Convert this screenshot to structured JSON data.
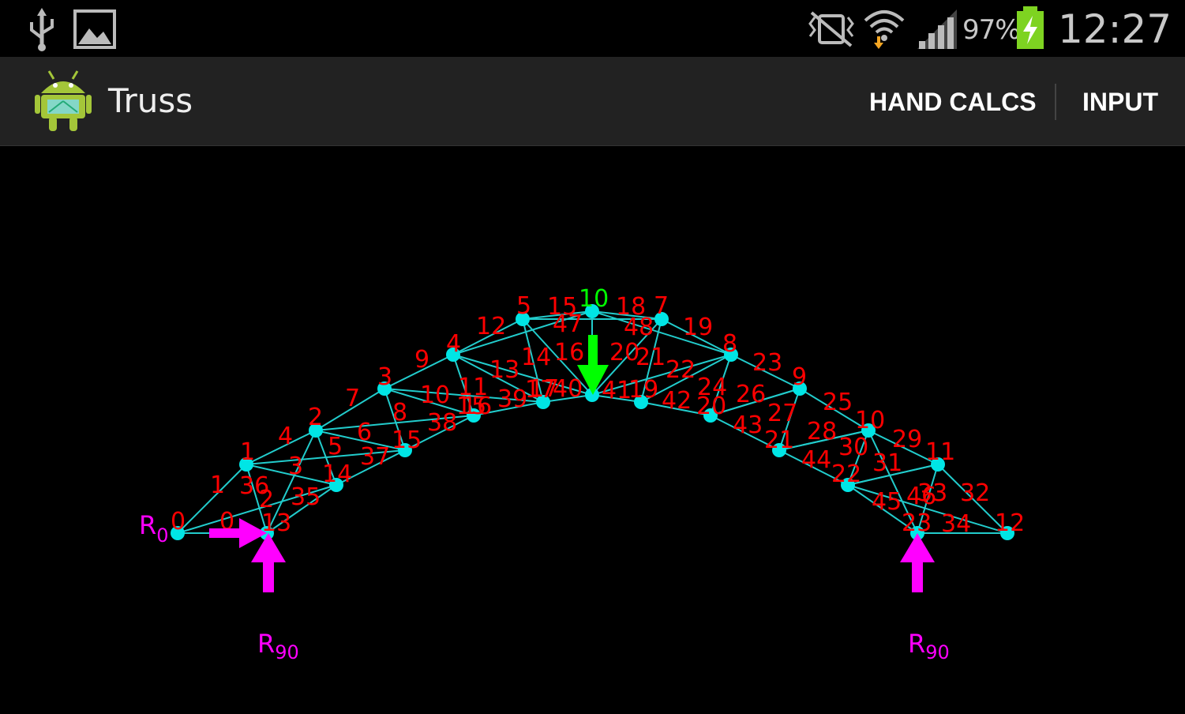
{
  "status_bar": {
    "icons": [
      "usb-icon",
      "gallery-icon",
      "vibrate-icon",
      "wifi-icon",
      "signal-icon",
      "battery-icon"
    ],
    "battery_percent": "97%",
    "time": "12:27",
    "colors": {
      "text": "#c8c8c8",
      "battery_fill": "#7ed321",
      "wifi_download": "#f5a623"
    }
  },
  "action_bar": {
    "app_icon": "android-app-icon",
    "title": "Truss",
    "actions": [
      {
        "label": "HAND CALCS"
      },
      {
        "label": "INPUT"
      }
    ]
  },
  "truss": {
    "colors": {
      "members": "#22cccc",
      "nodes": "#00e5e5",
      "labels": "#ff0000",
      "load": "#00ff00",
      "reactions": "#ff00ff"
    },
    "node_labels": [
      "0",
      "1",
      "2",
      "3",
      "4",
      "5",
      "10",
      "7",
      "8",
      "9",
      "10",
      "11",
      "12",
      "13",
      "14",
      "15",
      "15",
      "17",
      "19",
      "20",
      "21",
      "22",
      "23"
    ],
    "member_labels": [
      "1",
      "0",
      "36",
      "2",
      "3",
      "35",
      "4",
      "5",
      "6",
      "37",
      "7",
      "8",
      "15",
      "38",
      "9",
      "10",
      "11",
      "16",
      "13",
      "39",
      "12",
      "14",
      "15",
      "16",
      "17",
      "40",
      "18",
      "47",
      "48",
      "20",
      "21",
      "22",
      "41",
      "19",
      "42",
      "23",
      "24",
      "26",
      "43",
      "27",
      "28",
      "25",
      "30",
      "44",
      "29",
      "31",
      "45",
      "46",
      "33",
      "32",
      "34"
    ],
    "load_label": "10",
    "reaction_labels": {
      "r0_main": "R",
      "r0_sub": "0",
      "r90_left_main": "R",
      "r90_left_sub": "90",
      "r90_right_main": "R",
      "r90_right_sub": "90"
    }
  }
}
